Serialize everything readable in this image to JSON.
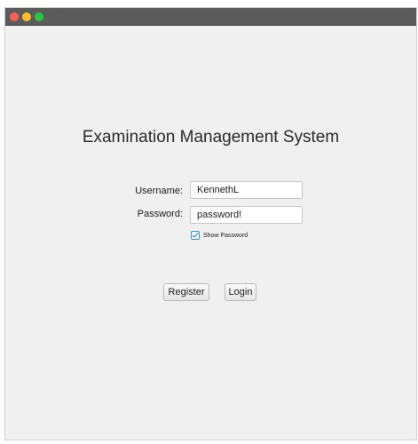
{
  "window": {
    "traffic_lights": {
      "close_color": "#ff5f57",
      "minimize_color": "#febc2e",
      "zoom_color": "#28c840"
    }
  },
  "app": {
    "title": "Examination Management System"
  },
  "form": {
    "username_label": "Username:",
    "username_value": "KennethL",
    "password_label": "Password:",
    "password_value": "password!",
    "show_password_label": "Show Password",
    "show_password_checked": true,
    "accent_color": "#3a90d8"
  },
  "buttons": {
    "register_label": "Register",
    "login_label": "Login"
  }
}
